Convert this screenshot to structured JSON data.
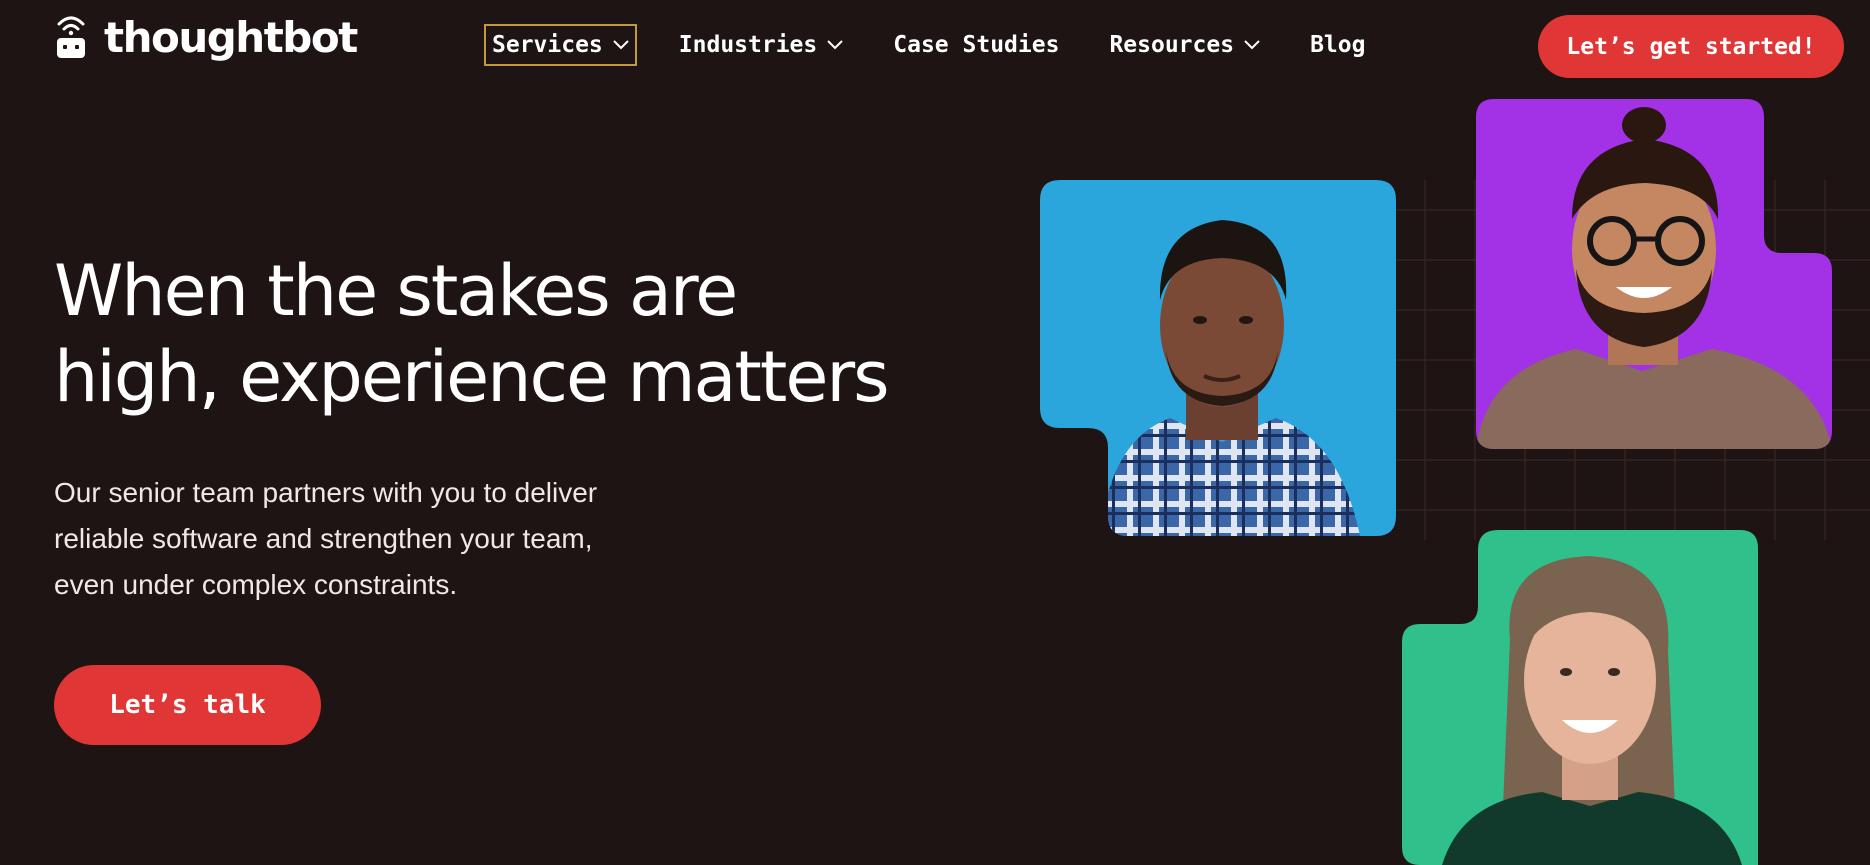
{
  "brand": {
    "name": "thoughtbot",
    "icon": "robot-wifi-icon"
  },
  "nav": {
    "items": [
      {
        "label": "Services",
        "has_dropdown": true,
        "focused": true
      },
      {
        "label": "Industries",
        "has_dropdown": true
      },
      {
        "label": "Case Studies",
        "has_dropdown": false
      },
      {
        "label": "Resources",
        "has_dropdown": true
      },
      {
        "label": "Blog",
        "has_dropdown": false
      }
    ],
    "cta_label": "Let’s get started!"
  },
  "hero": {
    "title_line1": "When the stakes are",
    "title_line2": "high, experience matters",
    "subtitle_line1": "Our senior team partners with you to deliver",
    "subtitle_line2": "reliable software and strengthen your team,",
    "subtitle_line3": "even under complex constraints.",
    "cta_label": "Let’s talk"
  },
  "portraits": [
    {
      "background": "#2ba6dc",
      "description": "portrait-man-plaid-shirt"
    },
    {
      "background": "#a331e6",
      "description": "portrait-man-glasses-beard"
    },
    {
      "background": "#2fc08c",
      "description": "portrait-woman-smiling"
    }
  ],
  "colors": {
    "page_background": "#1f1414",
    "accent_red": "#e03636",
    "focus_outline": "#c29a3d",
    "text": "#ffffff"
  }
}
